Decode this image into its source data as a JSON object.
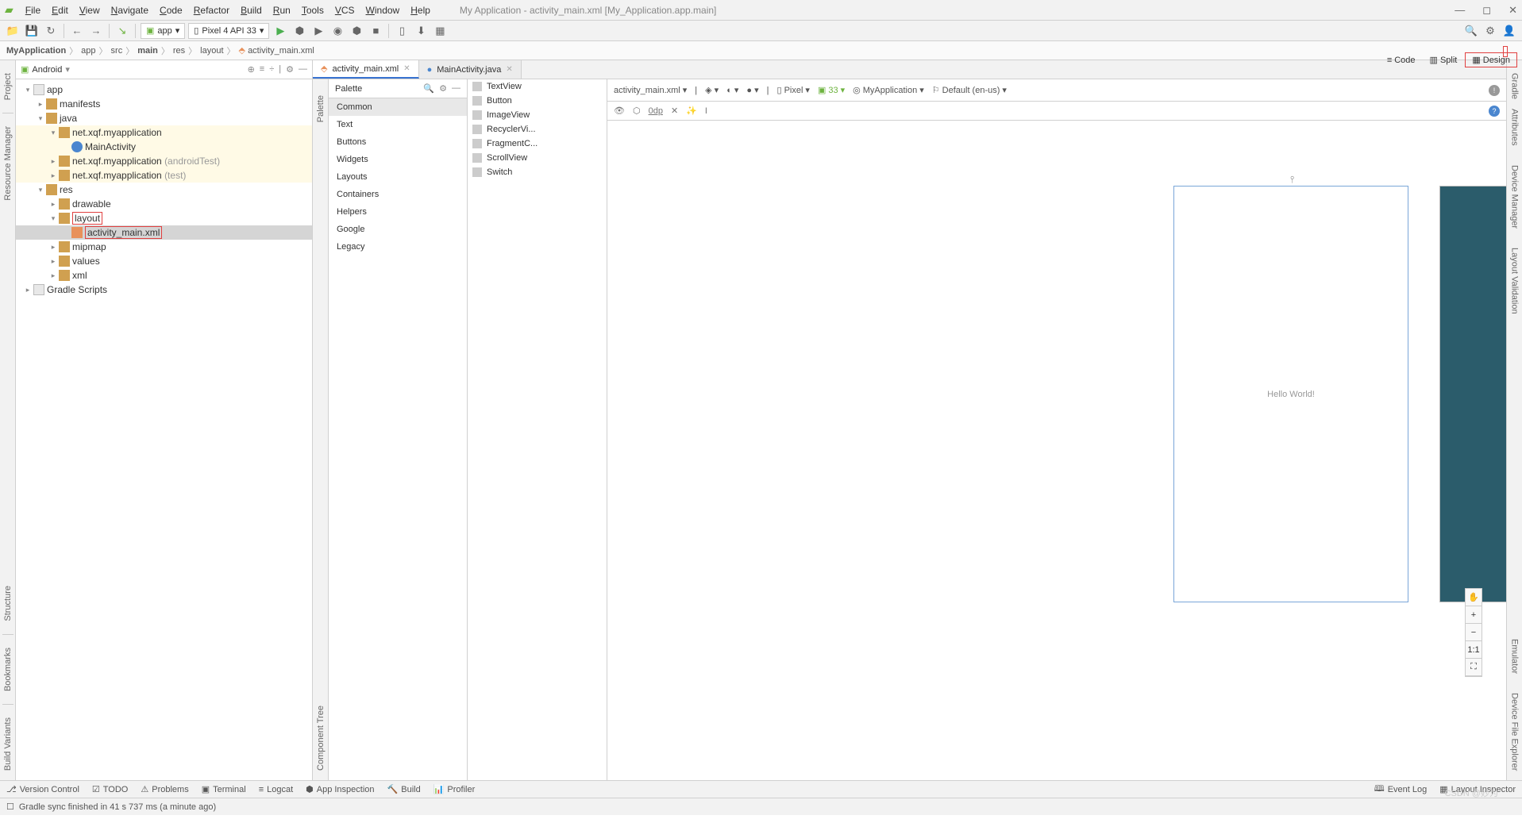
{
  "window_title": "My Application - activity_main.xml [My_Application.app.main]",
  "menu": [
    "File",
    "Edit",
    "View",
    "Navigate",
    "Code",
    "Refactor",
    "Build",
    "Run",
    "Tools",
    "VCS",
    "Window",
    "Help"
  ],
  "toolbar": {
    "module": "app",
    "device": "Pixel 4 API 33"
  },
  "breadcrumb": [
    "MyApplication",
    "app",
    "src",
    "main",
    "res",
    "layout",
    "activity_main.xml"
  ],
  "left_gutter": [
    "Project",
    "Resource Manager",
    "Structure",
    "Bookmarks",
    "Build Variants"
  ],
  "right_gutter": [
    "Gradle",
    "Attributes",
    "Device Manager",
    "Layout Validation",
    "Emulator",
    "Device File Explorer"
  ],
  "project": {
    "header": "Android",
    "tree": [
      {
        "d": 0,
        "exp": "v",
        "ic": "mod",
        "t": "app"
      },
      {
        "d": 1,
        "exp": ">",
        "ic": "fold",
        "t": "manifests"
      },
      {
        "d": 1,
        "exp": "v",
        "ic": "fold",
        "t": "java"
      },
      {
        "d": 2,
        "exp": "v",
        "ic": "pkg",
        "t": "net.xqf.myapplication",
        "hl": true
      },
      {
        "d": 3,
        "exp": "",
        "ic": "java",
        "t": "MainActivity",
        "hl": true
      },
      {
        "d": 2,
        "exp": ">",
        "ic": "pkg",
        "t": "net.xqf.myapplication",
        "suffix": "(androidTest)",
        "hl": true
      },
      {
        "d": 2,
        "exp": ">",
        "ic": "pkg",
        "t": "net.xqf.myapplication",
        "suffix": "(test)",
        "hl": true
      },
      {
        "d": 1,
        "exp": "v",
        "ic": "fold",
        "t": "res"
      },
      {
        "d": 2,
        "exp": ">",
        "ic": "fold",
        "t": "drawable"
      },
      {
        "d": 2,
        "exp": "v",
        "ic": "fold",
        "t": "layout",
        "red": true
      },
      {
        "d": 3,
        "exp": "",
        "ic": "xml",
        "t": "activity_main.xml",
        "sel": true,
        "red": true
      },
      {
        "d": 2,
        "exp": ">",
        "ic": "fold",
        "t": "mipmap"
      },
      {
        "d": 2,
        "exp": ">",
        "ic": "fold",
        "t": "values"
      },
      {
        "d": 2,
        "exp": ">",
        "ic": "fold",
        "t": "xml"
      },
      {
        "d": 0,
        "exp": ">",
        "ic": "mod",
        "t": "Gradle Scripts"
      }
    ]
  },
  "tabs": [
    {
      "label": "activity_main.xml",
      "active": true,
      "icon": "xml"
    },
    {
      "label": "MainActivity.java",
      "active": false,
      "icon": "java"
    }
  ],
  "palette": {
    "title": "Palette",
    "cats": [
      "Common",
      "Text",
      "Buttons",
      "Widgets",
      "Layouts",
      "Containers",
      "Helpers",
      "Google",
      "Legacy"
    ],
    "components": [
      "TextView",
      "Button",
      "ImageView",
      "RecyclerVi...",
      "FragmentC...",
      "ScrollView",
      "Switch"
    ]
  },
  "component_tree": "Component Tree",
  "canvas_tb": {
    "file": "activity_main.xml",
    "device": "Pixel",
    "api": "33",
    "theme": "MyApplication",
    "locale": "Default (en-us)",
    "margin": "0dp"
  },
  "view_modes": {
    "code": "Code",
    "split": "Split",
    "design": "Design"
  },
  "zoom": {
    "plus": "+",
    "minus": "−",
    "fit": "1:1",
    "pan": "⛶"
  },
  "preview_text": "Hello World!",
  "bottom_bar": {
    "items": [
      "Version Control",
      "TODO",
      "Problems",
      "Terminal",
      "Logcat",
      "App Inspection",
      "Build",
      "Profiler"
    ],
    "right": [
      "Event Log",
      "Layout Inspector"
    ]
  },
  "status": "Gradle sync finished in 41 s 737 ms (a minute ago)",
  "watermark": "CSDN @妙为"
}
